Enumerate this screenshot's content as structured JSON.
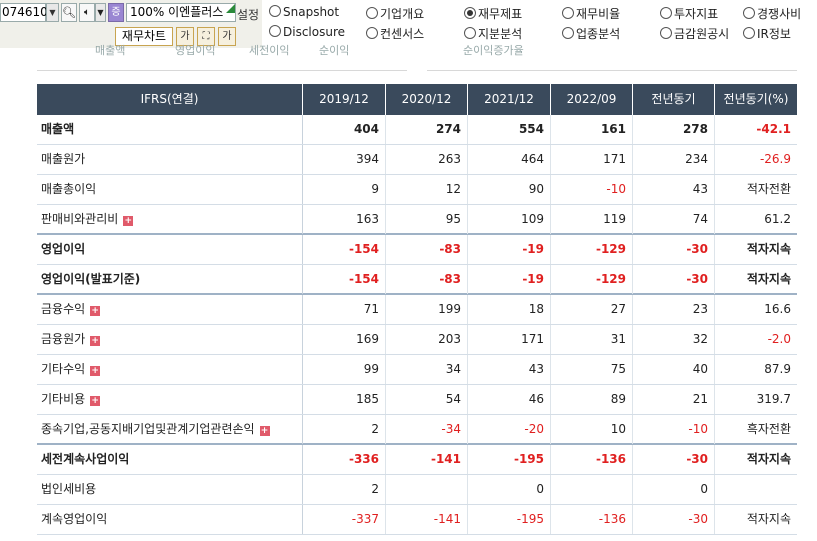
{
  "toolbar": {
    "stock_code": "074610",
    "zoom_label": "100%",
    "company_name": "이엔플러스",
    "settings_label": "설정",
    "fin_icon_label": "증",
    "chart_button": "재무차트",
    "small_buttons": [
      "가",
      "⛶",
      "가"
    ],
    "radios": [
      {
        "label": "Snapshot",
        "selected": false
      },
      {
        "label": "기업개요",
        "selected": false
      },
      {
        "label": "재무제표",
        "selected": true
      },
      {
        "label": "재무비율",
        "selected": false
      },
      {
        "label": "투자지표",
        "selected": false
      },
      {
        "label": "경쟁사비",
        "selected": false
      },
      {
        "label": "Disclosure",
        "selected": false
      },
      {
        "label": "컨센서스",
        "selected": false
      },
      {
        "label": "지분분석",
        "selected": false
      },
      {
        "label": "업종분석",
        "selected": false
      },
      {
        "label": "금감원공시",
        "selected": false
      },
      {
        "label": "IR정보",
        "selected": false
      }
    ]
  },
  "legend": {
    "left_items": [
      "매출액",
      "영업이익",
      "세전이익",
      "순이익"
    ],
    "right_item": "순이익증가율"
  },
  "table": {
    "header_label": "IFRS(연결)",
    "columns": [
      "2019/12",
      "2020/12",
      "2021/12",
      "2022/09",
      "전년동기",
      "전년동기(%)"
    ],
    "rows": [
      {
        "label": "매출액",
        "bold": true,
        "expand": false,
        "values": [
          "404",
          "274",
          "554",
          "161",
          "278",
          "-42.1"
        ]
      },
      {
        "label": "매출원가",
        "bold": false,
        "expand": false,
        "values": [
          "394",
          "263",
          "464",
          "171",
          "234",
          "-26.9"
        ]
      },
      {
        "label": "매출총이익",
        "bold": false,
        "expand": false,
        "values": [
          "9",
          "12",
          "90",
          "-10",
          "43",
          "적자전환"
        ]
      },
      {
        "label": "판매비와관리비",
        "bold": false,
        "expand": true,
        "values": [
          "163",
          "95",
          "109",
          "119",
          "74",
          "61.2"
        ]
      },
      {
        "label": "영업이익",
        "bold": true,
        "expand": false,
        "values": [
          "-154",
          "-83",
          "-19",
          "-129",
          "-30",
          "적자지속"
        ]
      },
      {
        "label": "영업이익(발표기준)",
        "bold": true,
        "expand": false,
        "values": [
          "-154",
          "-83",
          "-19",
          "-129",
          "-30",
          "적자지속"
        ]
      },
      {
        "label": "금융수익",
        "bold": false,
        "expand": true,
        "values": [
          "71",
          "199",
          "18",
          "27",
          "23",
          "16.6"
        ]
      },
      {
        "label": "금융원가",
        "bold": false,
        "expand": true,
        "values": [
          "169",
          "203",
          "171",
          "31",
          "32",
          "-2.0"
        ]
      },
      {
        "label": "기타수익",
        "bold": false,
        "expand": true,
        "values": [
          "99",
          "34",
          "43",
          "75",
          "40",
          "87.9"
        ]
      },
      {
        "label": "기타비용",
        "bold": false,
        "expand": true,
        "values": [
          "185",
          "54",
          "46",
          "89",
          "21",
          "319.7"
        ]
      },
      {
        "label": "종속기업,공동지배기업및관계기업관련손익",
        "bold": false,
        "expand": true,
        "values": [
          "2",
          "-34",
          "-20",
          "10",
          "-10",
          "흑자전환"
        ]
      },
      {
        "label": "세전계속사업이익",
        "bold": true,
        "expand": false,
        "values": [
          "-336",
          "-141",
          "-195",
          "-136",
          "-30",
          "적자지속"
        ]
      },
      {
        "label": "법인세비용",
        "bold": false,
        "expand": false,
        "values": [
          "2",
          "",
          "0",
          "",
          "0",
          ""
        ]
      },
      {
        "label": "계속영업이익",
        "bold": false,
        "expand": false,
        "values": [
          "-337",
          "-141",
          "-195",
          "-136",
          "-30",
          "적자지속"
        ]
      }
    ]
  },
  "colors": {
    "header_bg": "#3a4a5c",
    "negative": "#e02020",
    "toolbar_bg": "#f0f0ea",
    "expand_icon": "#e05a6a"
  }
}
